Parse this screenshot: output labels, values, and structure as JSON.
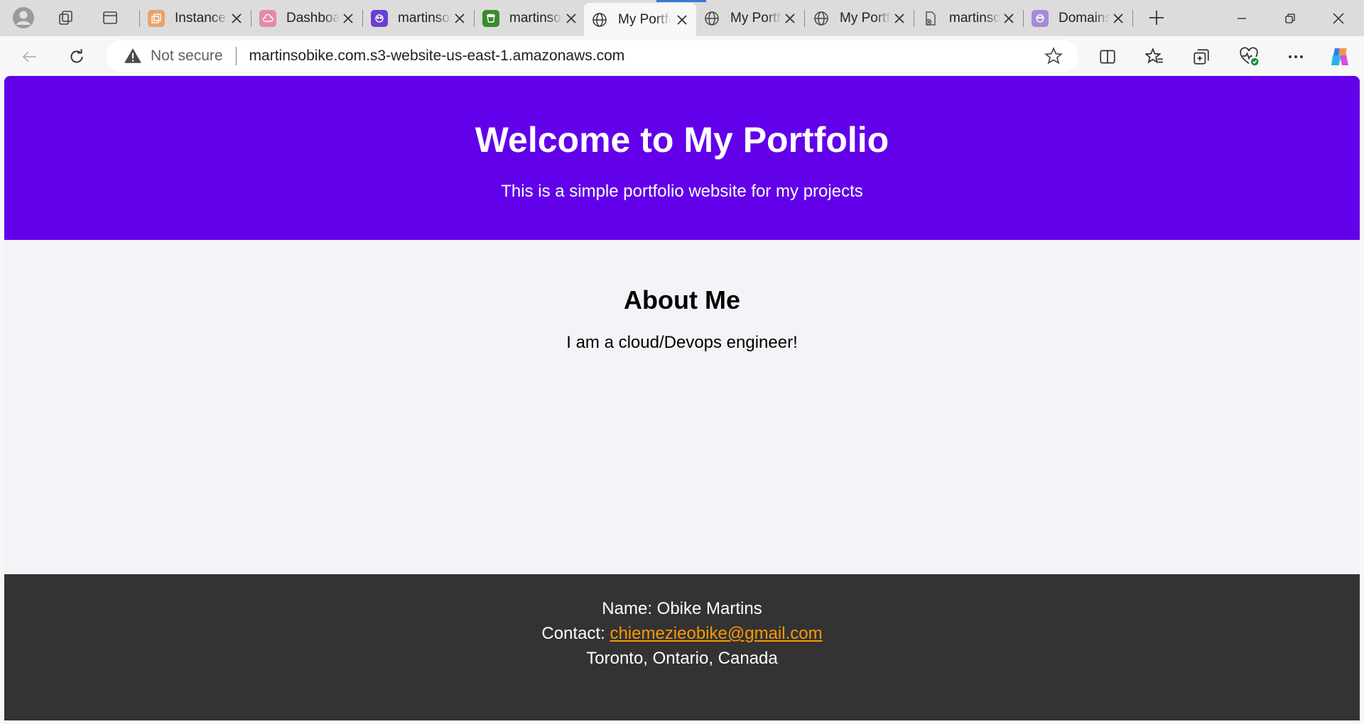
{
  "browser": {
    "tabs": [
      {
        "title": "Instances",
        "favicon": "aws-ec2-icon",
        "color": "#e8a36b"
      },
      {
        "title": "Dashboard",
        "favicon": "cloud-icon",
        "color": "#e48aa8"
      },
      {
        "title": "martinsobike",
        "favicon": "aws-route53-icon",
        "color": "#6a3fd1"
      },
      {
        "title": "martinsobike",
        "favicon": "aws-s3-icon",
        "color": "#3b8a2f"
      },
      {
        "title": "My Portfolio",
        "favicon": "globe-icon",
        "color": "#444444",
        "active": true
      },
      {
        "title": "My Portfolio",
        "favicon": "globe-icon",
        "color": "#444444"
      },
      {
        "title": "My Portfolio",
        "favicon": "globe-icon",
        "color": "#444444"
      },
      {
        "title": "martinsobike",
        "favicon": "document-error-icon",
        "color": "#666666"
      },
      {
        "title": "Domains",
        "favicon": "aws-route53-icon",
        "color": "#a58ad8"
      }
    ],
    "security_label": "Not secure",
    "url": "martinsobike.com.s3-website-us-east-1.amazonaws.com"
  },
  "page": {
    "hero": {
      "title": "Welcome to My Portfolio",
      "subtitle": "This is a simple portfolio website for my projects"
    },
    "about": {
      "heading": "About Me",
      "text": "I am a cloud/Devops engineer!"
    },
    "footer": {
      "name_line": "Name: Obike Martins",
      "contact_prefix": "Contact: ",
      "email": "chiemezieobike@gmail.com",
      "location": "Toronto, Ontario, Canada"
    }
  },
  "colors": {
    "hero_bg": "#6200ea",
    "footer_bg": "#333333",
    "link": "#ff9800",
    "page_bg": "#f4f4f8"
  }
}
